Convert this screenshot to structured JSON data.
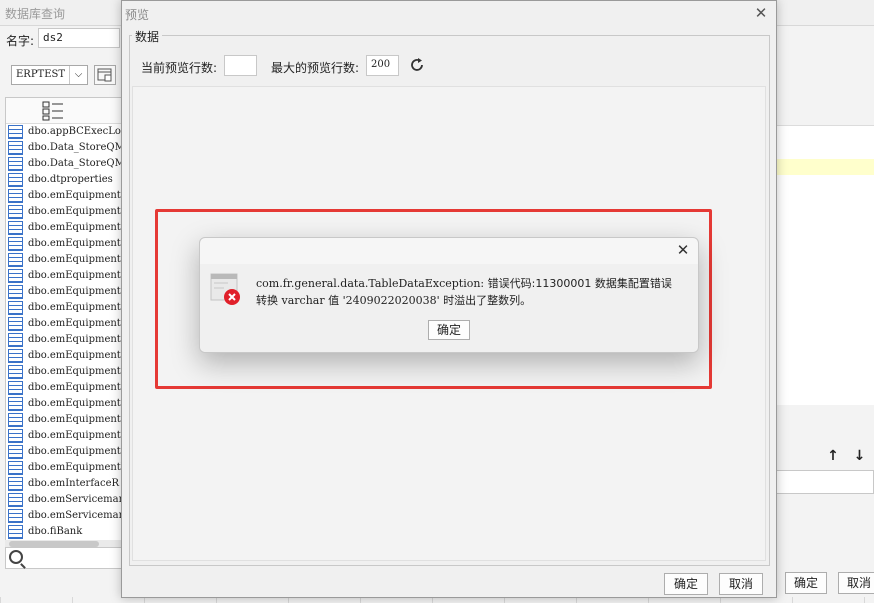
{
  "background_window": {
    "title": "数据库查询",
    "name_label": "名字:",
    "name_value": "ds2",
    "database_select": "ERPTEST",
    "tables": [
      "dbo.appBCExecLog",
      "dbo.Data_StoreQM",
      "dbo.Data_StoreQM",
      "dbo.dtproperties",
      "dbo.emEquipment",
      "dbo.emEquipmentC",
      "dbo.emEquipmentC",
      "dbo.emEquipmentI",
      "dbo.emEquipmentI",
      "dbo.emEquipmentM",
      "dbo.emEquipmentM",
      "dbo.emEquipmentM",
      "dbo.emEquipmentS",
      "dbo.emEquipmentS",
      "dbo.emEquipmentS",
      "dbo.emEquipmentS",
      "dbo.emEquipmentS",
      "dbo.emEquipmentS",
      "dbo.emEquipmentS",
      "dbo.emEquipmentT",
      "dbo.emEquipmentU",
      "dbo.emEquipmentW",
      "dbo.emInterfaceR",
      "dbo.emServicemar",
      "dbo.emServicemar",
      "dbo.fiBank"
    ],
    "arrow_up": "↑",
    "arrow_down": "↓",
    "ok_label": "确定",
    "cancel_label": "取消"
  },
  "preview_dialog": {
    "title": "预览",
    "group_label": "数据",
    "current_rows_label": "当前预览行数:",
    "current_rows_value": "",
    "max_rows_label": "最大的预览行数:",
    "max_rows_value": "200",
    "ok_label": "确定",
    "cancel_label": "取消"
  },
  "error_dialog": {
    "line1_exception": "com.fr.general.data.TableDataException:",
    "line1_message": " 错误代码:11300001 数据集配置错误",
    "line2_prefix": "转换 ",
    "line2_type": "varchar",
    "line2_mid": " 值 '",
    "line2_value": "2409022020038",
    "line2_suffix": "' 时溢出了整数列。",
    "ok_label": "确定"
  },
  "colors": {
    "highlight_frame": "#e53935",
    "error_icon": "#e0202a",
    "table_icon": "#3a72c8"
  }
}
